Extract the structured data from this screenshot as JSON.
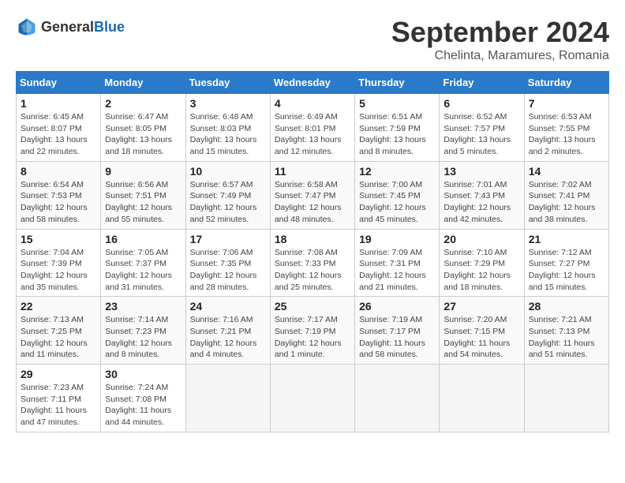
{
  "header": {
    "logo_general": "General",
    "logo_blue": "Blue",
    "title": "September 2024",
    "subtitle": "Chelinta, Maramures, Romania"
  },
  "calendar": {
    "days_of_week": [
      "Sunday",
      "Monday",
      "Tuesday",
      "Wednesday",
      "Thursday",
      "Friday",
      "Saturday"
    ],
    "weeks": [
      [
        {
          "day": "",
          "detail": ""
        },
        {
          "day": "2",
          "detail": "Sunrise: 6:47 AM\nSunset: 8:05 PM\nDaylight: 13 hours\nand 18 minutes."
        },
        {
          "day": "3",
          "detail": "Sunrise: 6:48 AM\nSunset: 8:03 PM\nDaylight: 13 hours\nand 15 minutes."
        },
        {
          "day": "4",
          "detail": "Sunrise: 6:49 AM\nSunset: 8:01 PM\nDaylight: 13 hours\nand 12 minutes."
        },
        {
          "day": "5",
          "detail": "Sunrise: 6:51 AM\nSunset: 7:59 PM\nDaylight: 13 hours\nand 8 minutes."
        },
        {
          "day": "6",
          "detail": "Sunrise: 6:52 AM\nSunset: 7:57 PM\nDaylight: 13 hours\nand 5 minutes."
        },
        {
          "day": "7",
          "detail": "Sunrise: 6:53 AM\nSunset: 7:55 PM\nDaylight: 13 hours\nand 2 minutes."
        }
      ],
      [
        {
          "day": "8",
          "detail": "Sunrise: 6:54 AM\nSunset: 7:53 PM\nDaylight: 12 hours\nand 58 minutes."
        },
        {
          "day": "9",
          "detail": "Sunrise: 6:56 AM\nSunset: 7:51 PM\nDaylight: 12 hours\nand 55 minutes."
        },
        {
          "day": "10",
          "detail": "Sunrise: 6:57 AM\nSunset: 7:49 PM\nDaylight: 12 hours\nand 52 minutes."
        },
        {
          "day": "11",
          "detail": "Sunrise: 6:58 AM\nSunset: 7:47 PM\nDaylight: 12 hours\nand 48 minutes."
        },
        {
          "day": "12",
          "detail": "Sunrise: 7:00 AM\nSunset: 7:45 PM\nDaylight: 12 hours\nand 45 minutes."
        },
        {
          "day": "13",
          "detail": "Sunrise: 7:01 AM\nSunset: 7:43 PM\nDaylight: 12 hours\nand 42 minutes."
        },
        {
          "day": "14",
          "detail": "Sunrise: 7:02 AM\nSunset: 7:41 PM\nDaylight: 12 hours\nand 38 minutes."
        }
      ],
      [
        {
          "day": "15",
          "detail": "Sunrise: 7:04 AM\nSunset: 7:39 PM\nDaylight: 12 hours\nand 35 minutes."
        },
        {
          "day": "16",
          "detail": "Sunrise: 7:05 AM\nSunset: 7:37 PM\nDaylight: 12 hours\nand 31 minutes."
        },
        {
          "day": "17",
          "detail": "Sunrise: 7:06 AM\nSunset: 7:35 PM\nDaylight: 12 hours\nand 28 minutes."
        },
        {
          "day": "18",
          "detail": "Sunrise: 7:08 AM\nSunset: 7:33 PM\nDaylight: 12 hours\nand 25 minutes."
        },
        {
          "day": "19",
          "detail": "Sunrise: 7:09 AM\nSunset: 7:31 PM\nDaylight: 12 hours\nand 21 minutes."
        },
        {
          "day": "20",
          "detail": "Sunrise: 7:10 AM\nSunset: 7:29 PM\nDaylight: 12 hours\nand 18 minutes."
        },
        {
          "day": "21",
          "detail": "Sunrise: 7:12 AM\nSunset: 7:27 PM\nDaylight: 12 hours\nand 15 minutes."
        }
      ],
      [
        {
          "day": "22",
          "detail": "Sunrise: 7:13 AM\nSunset: 7:25 PM\nDaylight: 12 hours\nand 11 minutes."
        },
        {
          "day": "23",
          "detail": "Sunrise: 7:14 AM\nSunset: 7:23 PM\nDaylight: 12 hours\nand 8 minutes."
        },
        {
          "day": "24",
          "detail": "Sunrise: 7:16 AM\nSunset: 7:21 PM\nDaylight: 12 hours\nand 4 minutes."
        },
        {
          "day": "25",
          "detail": "Sunrise: 7:17 AM\nSunset: 7:19 PM\nDaylight: 12 hours\nand 1 minute."
        },
        {
          "day": "26",
          "detail": "Sunrise: 7:19 AM\nSunset: 7:17 PM\nDaylight: 11 hours\nand 58 minutes."
        },
        {
          "day": "27",
          "detail": "Sunrise: 7:20 AM\nSunset: 7:15 PM\nDaylight: 11 hours\nand 54 minutes."
        },
        {
          "day": "28",
          "detail": "Sunrise: 7:21 AM\nSunset: 7:13 PM\nDaylight: 11 hours\nand 51 minutes."
        }
      ],
      [
        {
          "day": "29",
          "detail": "Sunrise: 7:23 AM\nSunset: 7:11 PM\nDaylight: 11 hours\nand 47 minutes."
        },
        {
          "day": "30",
          "detail": "Sunrise: 7:24 AM\nSunset: 7:08 PM\nDaylight: 11 hours\nand 44 minutes."
        },
        {
          "day": "",
          "detail": ""
        },
        {
          "day": "",
          "detail": ""
        },
        {
          "day": "",
          "detail": ""
        },
        {
          "day": "",
          "detail": ""
        },
        {
          "day": "",
          "detail": ""
        }
      ]
    ],
    "week1_day1": {
      "day": "1",
      "detail": "Sunrise: 6:45 AM\nSunset: 8:07 PM\nDaylight: 13 hours\nand 22 minutes."
    }
  }
}
